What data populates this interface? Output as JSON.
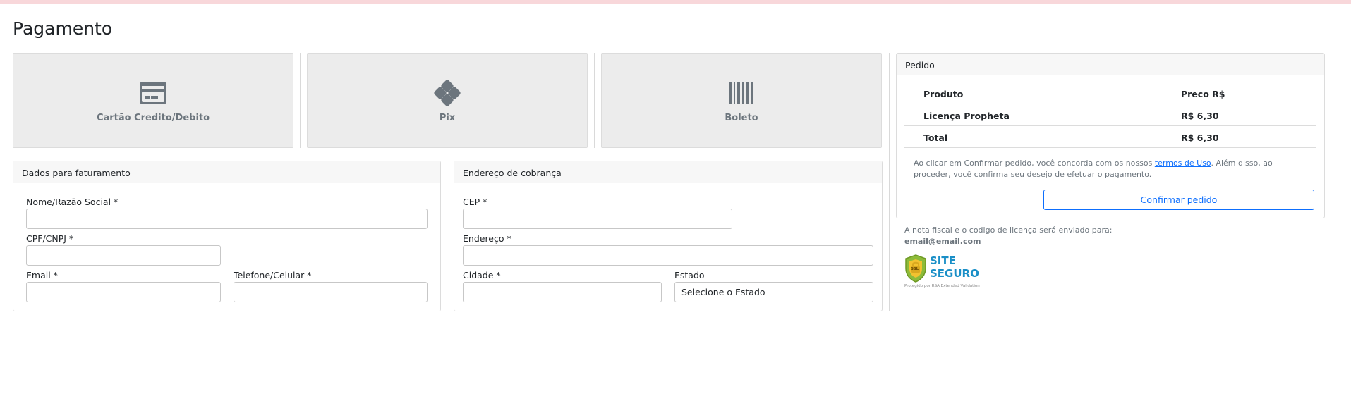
{
  "page": {
    "title": "Pagamento"
  },
  "methods": [
    {
      "label": "Cartão Credito/Debito",
      "icon": "credit-card-icon"
    },
    {
      "label": "Pix",
      "icon": "pix-icon"
    },
    {
      "label": "Boleto",
      "icon": "barcode-icon"
    }
  ],
  "billing": {
    "header": "Dados para faturamento",
    "name_label": "Nome/Razão Social *",
    "name_value": "",
    "doc_label": "CPF/CNPJ *",
    "doc_value": "",
    "email_label": "Email *",
    "email_value": "",
    "phone_label": "Telefone/Celular *",
    "phone_value": ""
  },
  "address": {
    "header": "Endereço de cobrança",
    "cep_label": "CEP *",
    "cep_value": "",
    "street_label": "Endereço *",
    "street_value": "",
    "city_label": "Cidade *",
    "city_value": "",
    "state_label": "Estado",
    "state_selected": "Selecione o Estado"
  },
  "order": {
    "header": "Pedido",
    "columns": [
      "Produto",
      "Preco R$"
    ],
    "rows": [
      {
        "product": "Licença Propheta",
        "price": "R$ 6,30"
      },
      {
        "product": "Total",
        "price": "R$ 6,30"
      }
    ],
    "terms_prefix": "Ao clicar em Confirmar pedido, você concorda com os nossos ",
    "terms_link": "termos de Uso",
    "terms_suffix": ". Além disso, ao proceder, você confirma seu desejo de efetuar o pagamento.",
    "confirm_label": "Confirmar pedido"
  },
  "invoice_note": {
    "text": "A nota fiscal e o codigo de licença será enviado para:",
    "email": "email@email.com"
  },
  "ssl": {
    "line1": "SITE",
    "line2": "SEGURO",
    "tag": "SSL",
    "subtitle": "Protegido por RSA Extended Validation"
  },
  "colors": {
    "accent": "#0d6efd",
    "card_bg": "#ececec",
    "top_strip": "#f8d7da",
    "ssl_blue": "#1a8fc7"
  }
}
